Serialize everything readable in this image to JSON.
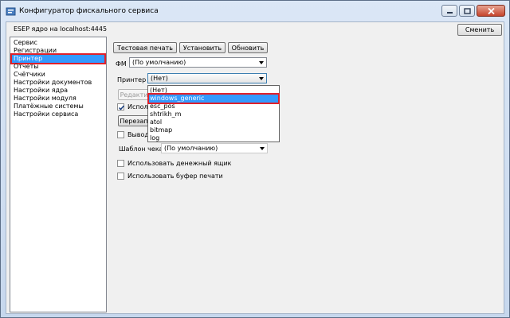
{
  "window": {
    "title": "Конфигуратор фискального сервиса",
    "controls": [
      "minimize",
      "maximize",
      "close"
    ]
  },
  "header": {
    "server_label": "ESEP ядро на localhost:4445",
    "change_button": "Сменить"
  },
  "sidebar": {
    "items": [
      {
        "label": "Сервис",
        "selected": false
      },
      {
        "label": "Регистрации",
        "selected": false
      },
      {
        "label": "Принтер",
        "selected": true
      },
      {
        "label": "Отчеты",
        "selected": false
      },
      {
        "label": "Счётчики",
        "selected": false
      },
      {
        "label": "Настройки документов",
        "selected": false
      },
      {
        "label": "Настройки ядра",
        "selected": false
      },
      {
        "label": "Настройки модуля",
        "selected": false
      },
      {
        "label": "Платёжные системы",
        "selected": false
      },
      {
        "label": "Настройки сервиса",
        "selected": false
      }
    ]
  },
  "toolbar": {
    "test_print": "Тестовая печать",
    "install": "Установить",
    "update": "Обновить"
  },
  "form": {
    "fm_label": "ФМ",
    "fm_value": "(По умолчанию)",
    "printer_label": "Принтер",
    "printer_value": "(Нет)",
    "edit_button": "Редакти",
    "use_checkbox_label": "Исполь",
    "use_checked": true,
    "reload_button": "Перезап",
    "output_checkbox_label": "Вывод с",
    "output_checked": false,
    "receipt_template_label": "Шаблон чека",
    "receipt_template_value": "(По умолчанию)",
    "cash_drawer_label": "Использовать денежный ящик",
    "cash_drawer_checked": false,
    "print_buffer_label": "Использовать буфер печати",
    "print_buffer_checked": false
  },
  "printer_dropdown": {
    "options": [
      "(Нет)",
      "windows_generic",
      "esc_pos",
      "shtrikh_m",
      "atol",
      "bitmap",
      "log"
    ],
    "highlighted": "windows_generic"
  },
  "colors": {
    "selection": "#3399ff",
    "highlight_outline": "#e0202a",
    "window_frame": "#dbe7f6"
  }
}
